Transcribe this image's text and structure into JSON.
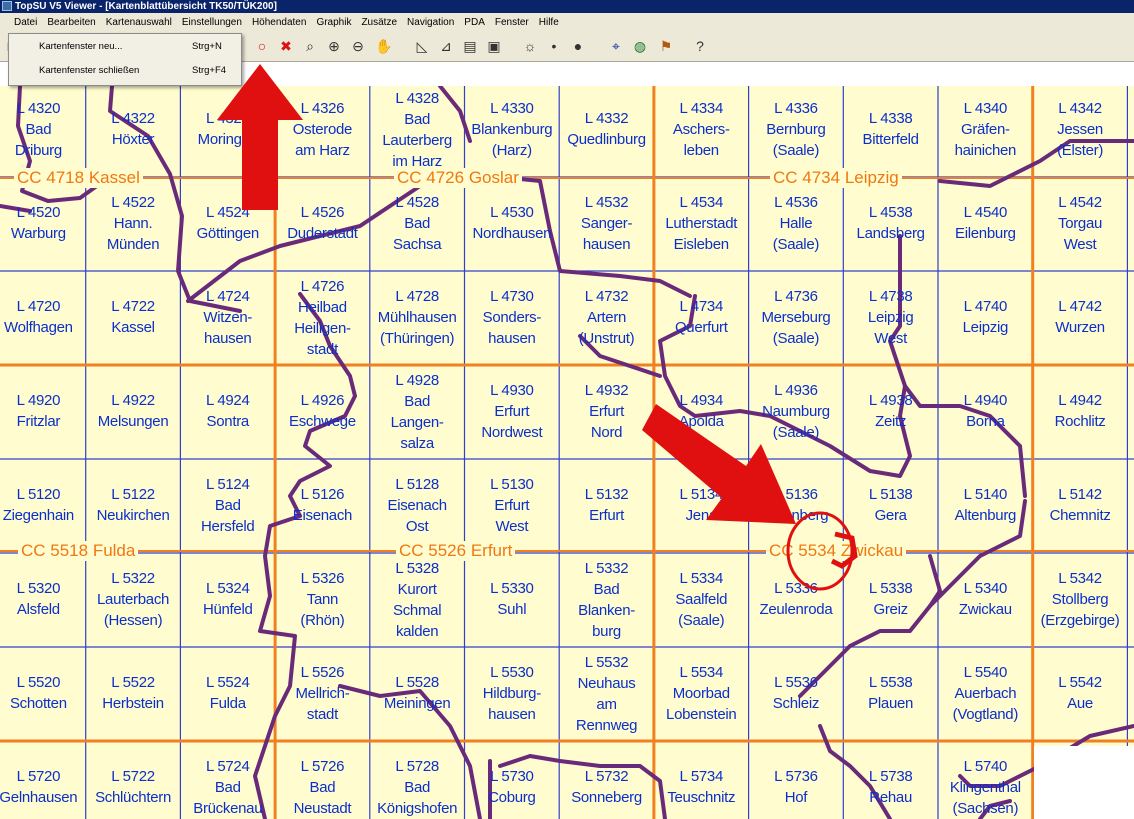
{
  "window": {
    "title": "TopSU V5 Viewer - [Kartenblattübersicht TK50/TÜK200]"
  },
  "menu": [
    "Datei",
    "Bearbeiten",
    "Kartenauswahl",
    "Einstellungen",
    "Höhendaten",
    "Graphik",
    "Zusätze",
    "Navigation",
    "PDA",
    "Fenster",
    "Hilfe"
  ],
  "dropdown": {
    "items": [
      {
        "label": "Kartenfenster neu...",
        "shortcut": "Strg+N"
      },
      {
        "label": "Kartenfenster schließen",
        "shortcut": "Strg+F4"
      }
    ]
  },
  "toolbar": {
    "icons": [
      "new-window-icon",
      "print-icon",
      "tool-icon",
      "circle-select-icon",
      "delete-selection-icon",
      "zoom-icon",
      "zoom-in-icon",
      "zoom-out-icon",
      "hand-pan-icon",
      "measure-icon",
      "stairs-icon",
      "chart-icon",
      "map-frame-icon",
      "sun-icon",
      "small-dot-icon",
      "big-dot-icon",
      "gps-icon",
      "globe-icon",
      "map-icon",
      "help-icon"
    ]
  },
  "colors": {
    "map_background": "#fffccf",
    "grid_blue": "#3040cc",
    "cc_orange": "#f08020",
    "sheet_label": "#0b2fcc",
    "border_purple": "#6a2a7a",
    "annotation_red": "#e01010",
    "titlebar": "#0a246a"
  },
  "cc_labels": [
    "CC 4718 Kassel",
    "CC 4726 Goslar",
    "CC 4734 Leipzig",
    "CC 5518 Fulda",
    "CC 5526 Erfurt",
    "CC 5534 Zwickau"
  ],
  "grid": [
    [
      {
        "num": "L 4320",
        "name": "Bad\nDriburg"
      },
      {
        "num": "L 4322",
        "name": "Höxter"
      },
      {
        "num": "L 4324",
        "name": "Moringen"
      },
      {
        "num": "L 4326",
        "name": "Osterode\nam Harz"
      },
      {
        "num": "L 4328",
        "name": "Bad\nLauterberg\nim Harz"
      },
      {
        "num": "L 4330",
        "name": "Blankenburg\n(Harz)"
      },
      {
        "num": "L 4332",
        "name": "Quedlinburg"
      },
      {
        "num": "L 4334",
        "name": "Aschers-\nleben"
      },
      {
        "num": "L 4336",
        "name": "Bernburg\n(Saale)"
      },
      {
        "num": "L 4338",
        "name": "Bitterfeld"
      },
      {
        "num": "L 4340",
        "name": "Gräfen-\nhainichen"
      },
      {
        "num": "L 4342",
        "name": "Jessen\n(Elster)"
      }
    ],
    [
      {
        "num": "L 4520",
        "name": "Warburg"
      },
      {
        "num": "L 4522",
        "name": "Hann.\nMünden"
      },
      {
        "num": "L 4524",
        "name": "Göttingen"
      },
      {
        "num": "L 4526",
        "name": "Duderstadt"
      },
      {
        "num": "L 4528",
        "name": "Bad\nSachsa"
      },
      {
        "num": "L 4530",
        "name": "Nordhausen"
      },
      {
        "num": "L 4532",
        "name": "Sanger-\nhausen"
      },
      {
        "num": "L 4534",
        "name": "Lutherstadt\nEisleben"
      },
      {
        "num": "L 4536",
        "name": "Halle\n(Saale)"
      },
      {
        "num": "L 4538",
        "name": "Landsberg"
      },
      {
        "num": "L 4540",
        "name": "Eilenburg"
      },
      {
        "num": "L 4542",
        "name": "Torgau\nWest"
      }
    ],
    [
      {
        "num": "L 4720",
        "name": "Wolfhagen"
      },
      {
        "num": "L 4722",
        "name": "Kassel"
      },
      {
        "num": "L 4724",
        "name": "Witzen-\nhausen"
      },
      {
        "num": "L 4726",
        "name": "Heilbad\nHeiligen-\nstadt"
      },
      {
        "num": "L 4728",
        "name": "Mühlhausen\n(Thüringen)"
      },
      {
        "num": "L 4730",
        "name": "Sonders-\nhausen"
      },
      {
        "num": "L 4732",
        "name": "Artern\n(Unstrut)"
      },
      {
        "num": "L 4734",
        "name": "Querfurt"
      },
      {
        "num": "L 4736",
        "name": "Merseburg\n(Saale)"
      },
      {
        "num": "L 4738",
        "name": "Leipzig\nWest"
      },
      {
        "num": "L 4740",
        "name": "Leipzig"
      },
      {
        "num": "L 4742",
        "name": "Wurzen"
      }
    ],
    [
      {
        "num": "L 4920",
        "name": "Fritzlar"
      },
      {
        "num": "L 4922",
        "name": "Melsungen"
      },
      {
        "num": "L 4924",
        "name": "Sontra"
      },
      {
        "num": "L 4926",
        "name": "Eschwege"
      },
      {
        "num": "L 4928",
        "name": "Bad\nLangen-\nsalza"
      },
      {
        "num": "L 4930",
        "name": "Erfurt\nNordwest"
      },
      {
        "num": "L 4932",
        "name": "Erfurt\nNord"
      },
      {
        "num": "L 4934",
        "name": "Apolda"
      },
      {
        "num": "L 4936",
        "name": "Naumburg\n(Saale)"
      },
      {
        "num": "L 4938",
        "name": "Zeitz"
      },
      {
        "num": "L 4940",
        "name": "Borna"
      },
      {
        "num": "L 4942",
        "name": "Rochlitz"
      }
    ],
    [
      {
        "num": "L 5120",
        "name": "Ziegenhain"
      },
      {
        "num": "L 5122",
        "name": "Neukirchen"
      },
      {
        "num": "L 5124",
        "name": "Bad\nHersfeld"
      },
      {
        "num": "L 5126",
        "name": "Eisenach"
      },
      {
        "num": "L 5128",
        "name": "Eisenach\nOst"
      },
      {
        "num": "L 5130",
        "name": "Erfurt\nWest"
      },
      {
        "num": "L 5132",
        "name": "Erfurt"
      },
      {
        "num": "L 5134",
        "name": "Jena"
      },
      {
        "num": "L 5136",
        "name": "Eisenberg"
      },
      {
        "num": "L 5138",
        "name": "Gera"
      },
      {
        "num": "L 5140",
        "name": "Altenburg"
      },
      {
        "num": "L 5142",
        "name": "Chemnitz"
      }
    ],
    [
      {
        "num": "L 5320",
        "name": "Alsfeld"
      },
      {
        "num": "L 5322",
        "name": "Lauterbach\n(Hessen)"
      },
      {
        "num": "L 5324",
        "name": "Hünfeld"
      },
      {
        "num": "L 5326",
        "name": "Tann\n(Rhön)"
      },
      {
        "num": "L 5328",
        "name": "Kurort\nSchmal\nkalden"
      },
      {
        "num": "L 5330",
        "name": "Suhl"
      },
      {
        "num": "L 5332",
        "name": "Bad\nBlanken-\nburg"
      },
      {
        "num": "L 5334",
        "name": "Saalfeld\n(Saale)"
      },
      {
        "num": "L 5336",
        "name": "Zeulenroda"
      },
      {
        "num": "L 5338",
        "name": "Greiz"
      },
      {
        "num": "L 5340",
        "name": "Zwickau"
      },
      {
        "num": "L 5342",
        "name": "Stollberg\n(Erzgebirge)"
      }
    ],
    [
      {
        "num": "L 5520",
        "name": "Schotten"
      },
      {
        "num": "L 5522",
        "name": "Herbstein"
      },
      {
        "num": "L 5524",
        "name": "Fulda"
      },
      {
        "num": "L 5526",
        "name": "Mellrich-\nstadt"
      },
      {
        "num": "L 5528",
        "name": "Meiningen"
      },
      {
        "num": "L 5530",
        "name": "Hildburg-\nhausen"
      },
      {
        "num": "L 5532",
        "name": "Neuhaus\nam\nRennweg"
      },
      {
        "num": "L 5534",
        "name": "Moorbad\nLobenstein"
      },
      {
        "num": "L 5536",
        "name": "Schleiz"
      },
      {
        "num": "L 5538",
        "name": "Plauen"
      },
      {
        "num": "L 5540",
        "name": "Auerbach\n(Vogtland)"
      },
      {
        "num": "L 5542",
        "name": "Aue"
      }
    ],
    [
      {
        "num": "L 5720",
        "name": "Gelnhausen"
      },
      {
        "num": "L 5722",
        "name": "Schlüchtern"
      },
      {
        "num": "L 5724",
        "name": "Bad\nBrückenau"
      },
      {
        "num": "L 5726",
        "name": "Bad\nNeustadt"
      },
      {
        "num": "L 5728",
        "name": "Bad\nKönigshofen"
      },
      {
        "num": "L 5730",
        "name": "Coburg"
      },
      {
        "num": "L 5732",
        "name": "Sonneberg"
      },
      {
        "num": "L 5734",
        "name": "Teuschnitz"
      },
      {
        "num": "L 5736",
        "name": "Hof"
      },
      {
        "num": "L 5738",
        "name": "Rehau"
      },
      {
        "num": "L 5740",
        "name": "Klingenthal\n(Sachsen)"
      },
      null
    ]
  ]
}
